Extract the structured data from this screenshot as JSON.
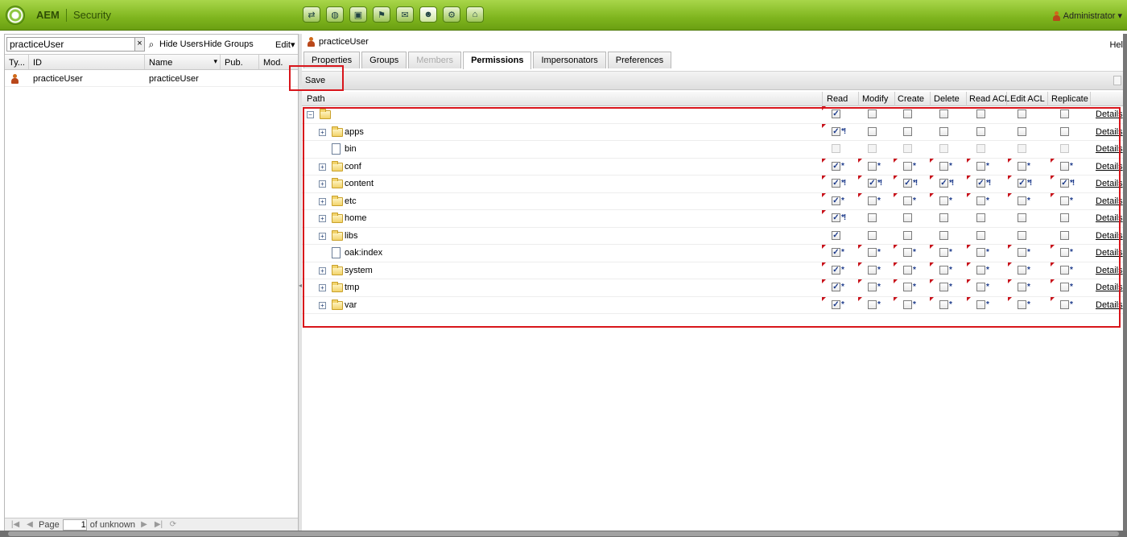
{
  "app": {
    "brand": "AEM",
    "section": "Security",
    "user": "Administrator"
  },
  "top_icons": [
    "workflow-icon",
    "globe-icon",
    "camera-icon",
    "campaign-icon",
    "mail-icon",
    "users-icon",
    "tools-icon",
    "tag-icon"
  ],
  "left": {
    "search_value": "practiceUser",
    "clear_label": "×",
    "search_glyph": "⌕",
    "hide_users": "Hide Users",
    "hide_groups": "Hide Groups",
    "edit": "Edit",
    "columns": [
      "Ty...",
      "ID",
      "Name",
      "Pub.",
      "Mod."
    ],
    "rows": [
      {
        "id": "practiceUser",
        "name": "practiceUser"
      }
    ],
    "pager": {
      "page_label": "Page",
      "page_value": "1",
      "of_label": "of unknown"
    }
  },
  "right": {
    "user": "practiceUser",
    "help": "Hel",
    "tabs": [
      "Properties",
      "Groups",
      "Members",
      "Permissions",
      "Impersonators",
      "Preferences"
    ],
    "save": "Save",
    "columns": [
      "Path",
      "Read",
      "Modify",
      "Create",
      "Delete",
      "Read ACL",
      "Edit ACL",
      "Replicate"
    ],
    "details_label": "Details",
    "nodes": [
      {
        "label": "",
        "level": 0,
        "kind": "folder",
        "toggle": "−",
        "cells": [
          "c",
          "u",
          "u",
          "u",
          "u",
          "u",
          "u"
        ]
      },
      {
        "label": "apps",
        "level": 1,
        "kind": "folder",
        "toggle": "+",
        "cells": [
          "c*!",
          "u",
          "u",
          "u",
          "u",
          "u",
          "u"
        ]
      },
      {
        "label": "bin",
        "level": 1,
        "kind": "file",
        "toggle": "",
        "cells": [
          "d",
          "d",
          "d",
          "d",
          "d",
          "d",
          "d"
        ]
      },
      {
        "label": "conf",
        "level": 1,
        "kind": "folder",
        "toggle": "+",
        "cells": [
          "c*",
          "u*",
          "u*",
          "u*",
          "u*",
          "u*",
          "u*"
        ]
      },
      {
        "label": "content",
        "level": 1,
        "kind": "folder",
        "toggle": "+",
        "cells": [
          "c*!",
          "c*!",
          "c*!",
          "c*!",
          "c*!",
          "c*!",
          "c*!"
        ]
      },
      {
        "label": "etc",
        "level": 1,
        "kind": "folder",
        "toggle": "+",
        "cells": [
          "c*",
          "u*",
          "u*",
          "u*",
          "u*",
          "u*",
          "u*"
        ]
      },
      {
        "label": "home",
        "level": 1,
        "kind": "folder",
        "toggle": "+",
        "cells": [
          "c*!",
          "u",
          "u",
          "u",
          "u",
          "u",
          "u"
        ]
      },
      {
        "label": "libs",
        "level": 1,
        "kind": "folder",
        "toggle": "+",
        "cells": [
          "c",
          "u",
          "u",
          "u",
          "u",
          "u",
          "u"
        ]
      },
      {
        "label": "oak:index",
        "level": 1,
        "kind": "file",
        "toggle": "",
        "cells": [
          "c*",
          "u*",
          "u*",
          "u*",
          "u*",
          "u*",
          "u*"
        ]
      },
      {
        "label": "system",
        "level": 1,
        "kind": "folder",
        "toggle": "+",
        "cells": [
          "c*",
          "u*",
          "u*",
          "u*",
          "u*",
          "u*",
          "u*"
        ]
      },
      {
        "label": "tmp",
        "level": 1,
        "kind": "folder",
        "toggle": "+",
        "cells": [
          "c*",
          "u*",
          "u*",
          "u*",
          "u*",
          "u*",
          "u*"
        ]
      },
      {
        "label": "var",
        "level": 1,
        "kind": "folder",
        "toggle": "+",
        "cells": [
          "c*",
          "u*",
          "u*",
          "u*",
          "u*",
          "u*",
          "u*"
        ]
      }
    ]
  }
}
